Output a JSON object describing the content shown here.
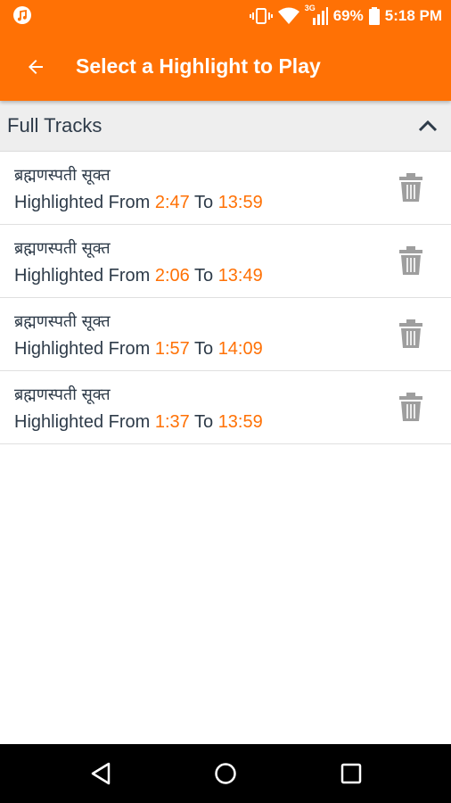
{
  "status_bar": {
    "app_icon": "music-note-icon",
    "battery_percent": "69%",
    "time": "5:18 PM",
    "network_label": "3G"
  },
  "toolbar": {
    "back_icon": "arrow-back-icon",
    "title": "Select a Highlight to Play"
  },
  "section": {
    "title": "Full Tracks",
    "toggle_icon": "chevron-up-icon"
  },
  "highlights": [
    {
      "title": "ब्रह्मणस्पती सूक्त",
      "from_label": "Highlighted From",
      "from": "2:47",
      "to_label": "To",
      "to": "13:59"
    },
    {
      "title": "ब्रह्मणस्पती सूक्त",
      "from_label": "Highlighted From",
      "from": "2:06",
      "to_label": "To",
      "to": "13:49"
    },
    {
      "title": "ब्रह्मणस्पती सूक्त",
      "from_label": "Highlighted From",
      "from": "1:57",
      "to_label": "To",
      "to": "14:09"
    },
    {
      "title": "ब्रह्मणस्पती सूक्त",
      "from_label": "Highlighted From",
      "from": "1:37",
      "to_label": "To",
      "to": "13:59"
    }
  ],
  "nav_bar": {
    "back_icon": "nav-back-icon",
    "home_icon": "nav-home-icon",
    "recents_icon": "nav-recents-icon"
  },
  "colors": {
    "accent": "#ff7105",
    "text": "#2e3b49",
    "icon_gray": "#9e9e9e",
    "section_bg": "#eeeeee"
  }
}
